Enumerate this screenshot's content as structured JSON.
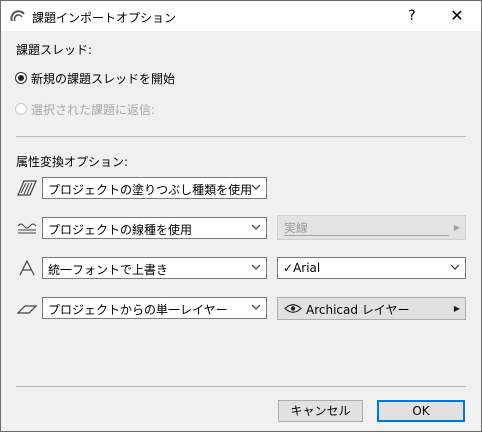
{
  "window": {
    "title": "課題インポートオプション",
    "help_label": "?",
    "close_label": "✕"
  },
  "thread_section": {
    "label": "課題スレッド:",
    "options": [
      {
        "label": "新規の課題スレッドを開始",
        "selected": true,
        "enabled": true
      },
      {
        "label": "選択された課題に返信:",
        "selected": false,
        "enabled": false
      }
    ]
  },
  "attribute_section": {
    "label": "属性変換オプション:",
    "rows": [
      {
        "icon": "fill-pattern-icon",
        "primary": "プロジェクトの塗りつぶし種類を使用"
      },
      {
        "icon": "line-type-icon",
        "primary": "プロジェクトの線種を使用",
        "secondary": "実線",
        "secondary_enabled": false
      },
      {
        "icon": "font-icon",
        "primary": "統一フォントで上書き",
        "secondary_check": "✓",
        "secondary": "Arial"
      },
      {
        "icon": "layer-icon",
        "primary": "プロジェクトからの単一レイヤー",
        "secondary_icon": "eye-icon",
        "secondary": "Archicad レイヤー"
      }
    ]
  },
  "footer": {
    "cancel_label": "キャンセル",
    "ok_label": "OK"
  },
  "colors": {
    "dialog_bg": "#f0f0f0",
    "accent": "#0078d7",
    "disabled_text": "#a8a8a8"
  }
}
